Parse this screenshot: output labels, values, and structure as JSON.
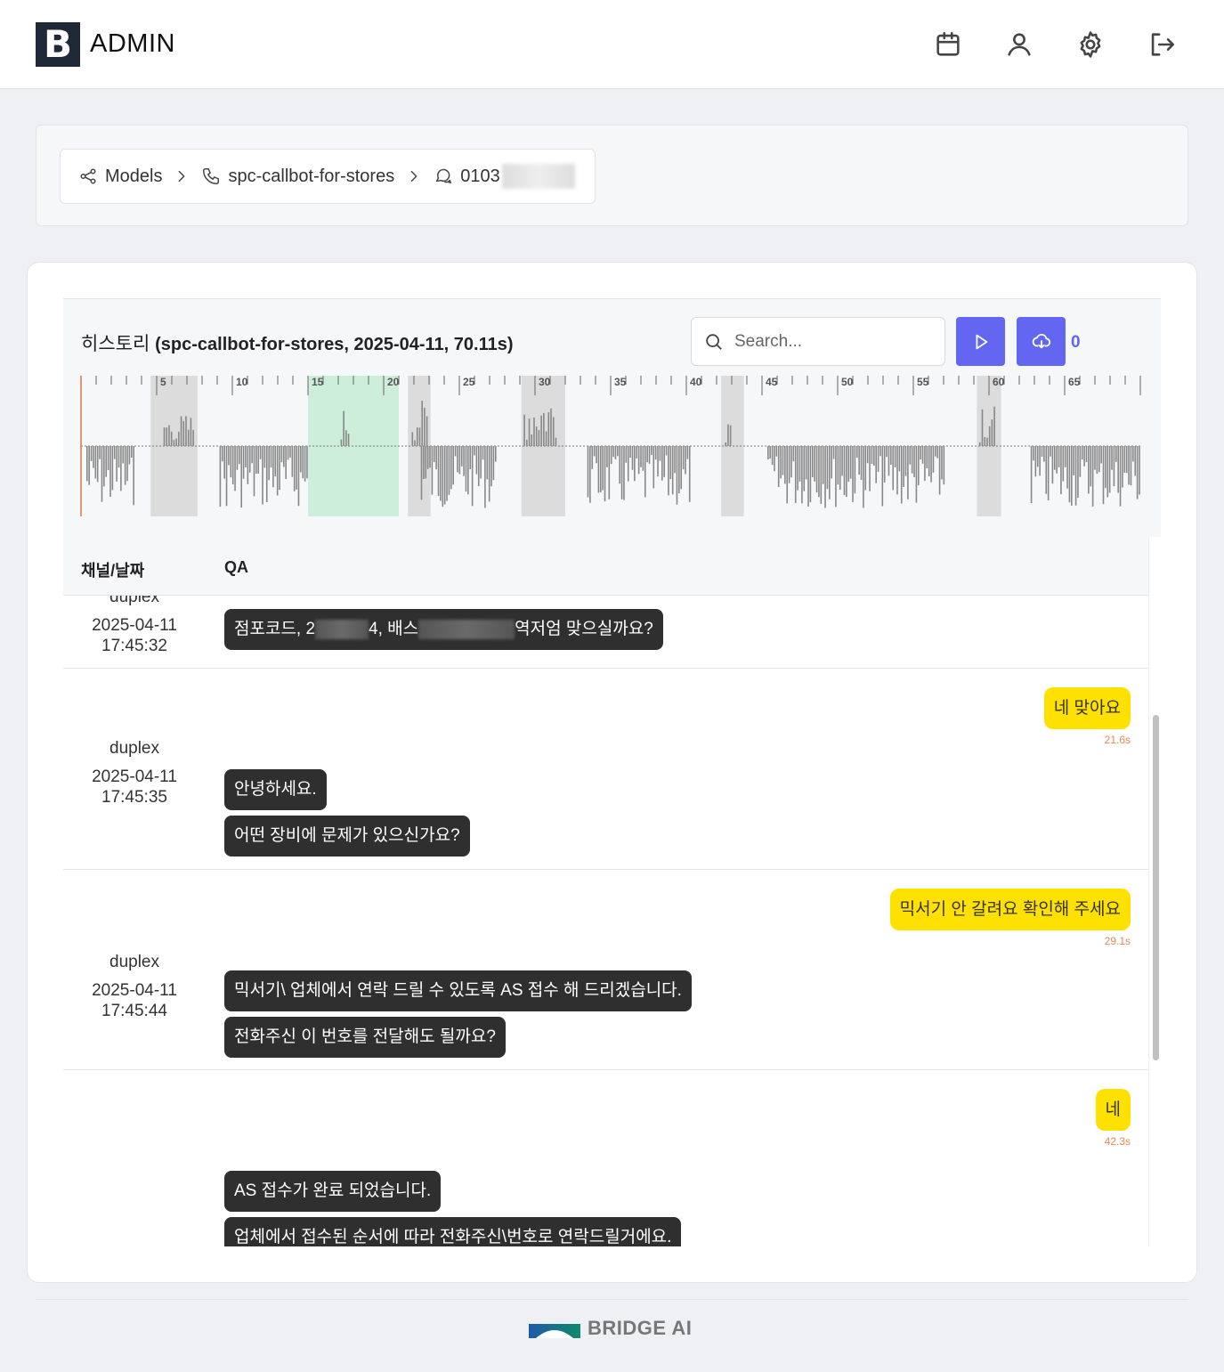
{
  "app": {
    "logo_letter": "B",
    "title": "ADMIN"
  },
  "topnav": {
    "icons": [
      "calendar-icon",
      "user-icon",
      "gear-icon",
      "logout-icon"
    ]
  },
  "breadcrumb": {
    "items": [
      {
        "label": "Models",
        "icon": "share-icon"
      },
      {
        "label": "spc-callbot-for-stores",
        "icon": "phone-icon"
      },
      {
        "label": "0103",
        "icon": "chat-icon"
      }
    ]
  },
  "history": {
    "title": "히스토리",
    "subtitle": "(spc-callbot-for-stores, 2025-04-11, 70.11s)",
    "search_placeholder": "Search...",
    "count": "0",
    "accent_color": "#6366f1",
    "timeline_ticks": [
      "5",
      "10",
      "15",
      "20",
      "25",
      "30",
      "35",
      "40",
      "45",
      "50",
      "55",
      "60",
      "65"
    ],
    "duration_s": 70.11
  },
  "table": {
    "headers": {
      "channel_date": "채널/날짜",
      "qa": "QA"
    },
    "rows": [
      {
        "channel": "duplex",
        "date": "2025-04-11",
        "time": "17:45:32",
        "bot": {
          "parts": [
            "점포코드, 2",
            "4, 배스",
            "역저엄 맞으실까요?"
          ]
        }
      },
      {
        "channel": "duplex",
        "date": "2025-04-11",
        "time": "17:45:35",
        "user": {
          "text": "네 맞아요",
          "ts": "21.6s"
        },
        "bot_msgs": [
          "안녕하세요.",
          "어떤 장비에 문제가 있으신가요?"
        ]
      },
      {
        "channel": "duplex",
        "date": "2025-04-11",
        "time": "17:45:44",
        "user": {
          "text": "믹서기 안 갈려요 확인해 주세요",
          "ts": "29.1s"
        },
        "bot_msgs": [
          "믹서기\\ 업체에서 연락 드릴 수 있도록 AS 접수 해 드리겠습니다.",
          "전화주신 이 번호를 전달해도 될까요?"
        ]
      },
      {
        "channel": "",
        "date": "",
        "time": "",
        "user": {
          "text": "네",
          "ts": "42.3s"
        },
        "bot_msgs": [
          "AS 접수가 완료 되었습니다.",
          "업체에서 접수된 순서에 따라 전화주신\\번호로 연락드릴거에요."
        ]
      }
    ]
  },
  "footer": {
    "brand": "BRIDGE AI"
  }
}
